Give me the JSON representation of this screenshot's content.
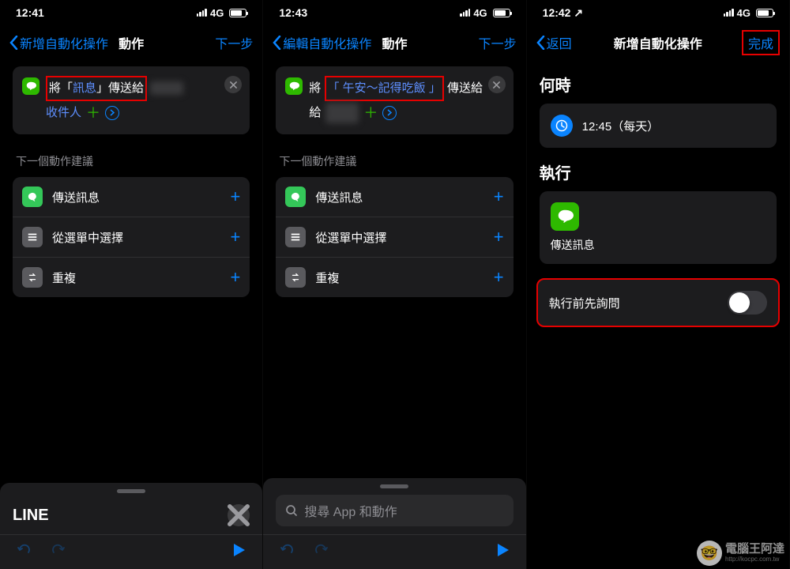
{
  "status": {
    "t1": "12:41",
    "t2": "12:43",
    "t3": "12:42",
    "net": "4G",
    "loc": "↗"
  },
  "p1": {
    "back": "新增自動化操作",
    "title": "動作",
    "next": "下一步",
    "action": {
      "pre": "將「",
      "msg": "訊息",
      "post": "」傳送給",
      "recip": "收件人"
    },
    "suggest_h": "下一個動作建議",
    "suggestions": [
      {
        "label": "傳送訊息",
        "type": "green"
      },
      {
        "label": "從選單中選擇",
        "type": "gray"
      },
      {
        "label": "重複",
        "type": "gray"
      }
    ],
    "sheet_title": "LINE"
  },
  "p2": {
    "back": "編輯自動化操作",
    "title": "動作",
    "next": "下一步",
    "action": {
      "pre": "將",
      "msg": "「 午安～記得吃飯 」",
      "post": "傳送給"
    },
    "search_ph": "搜尋 App 和動作"
  },
  "p3": {
    "back": "返回",
    "title": "新增自動化操作",
    "done": "完成",
    "when_h": "何時",
    "when_v": "12:45（每天）",
    "exec_h": "執行",
    "exec_v": "傳送訊息",
    "ask": "執行前先詢問"
  },
  "wm": {
    "title": "電腦王阿達",
    "url": "http://kocpc.com.tw"
  }
}
